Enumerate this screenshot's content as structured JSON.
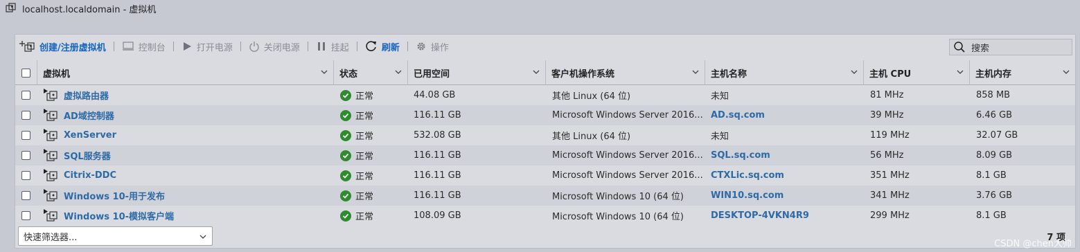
{
  "window": {
    "title": "localhost.localdomain - 虚拟机"
  },
  "toolbar": {
    "create": "创建/注册虚拟机",
    "console": "控制台",
    "power_on": "打开电源",
    "power_off": "关闭电源",
    "suspend": "挂起",
    "refresh": "刷新",
    "actions": "操作",
    "search_placeholder": "搜索"
  },
  "columns": [
    "虚拟机",
    "状态",
    "已用空间",
    "客户机操作系统",
    "主机名称",
    "主机 CPU",
    "主机内存"
  ],
  "rows": [
    {
      "name": "虚拟路由器",
      "status": "正常",
      "space": "44.08 GB",
      "os": "其他 Linux (64 位)",
      "host": "未知",
      "host_link": false,
      "cpu": "81 MHz",
      "mem": "858 MB"
    },
    {
      "name": "AD域控制器",
      "status": "正常",
      "space": "116.11 GB",
      "os": "Microsoft Windows Server 2016...",
      "host": "AD.sq.com",
      "host_link": true,
      "cpu": "39 MHz",
      "mem": "6.46 GB"
    },
    {
      "name": "XenServer",
      "status": "正常",
      "space": "532.08 GB",
      "os": "其他 Linux (64 位)",
      "host": "未知",
      "host_link": false,
      "cpu": "119 MHz",
      "mem": "32.07 GB"
    },
    {
      "name": "SQL服务器",
      "status": "正常",
      "space": "116.11 GB",
      "os": "Microsoft Windows Server 2016...",
      "host": "SQL.sq.com",
      "host_link": true,
      "cpu": "56 MHz",
      "mem": "8.09 GB"
    },
    {
      "name": "Citrix-DDC",
      "status": "正常",
      "space": "116.11 GB",
      "os": "Microsoft Windows Server 2016...",
      "host": "CTXLic.sq.com",
      "host_link": true,
      "cpu": "351 MHz",
      "mem": "8.1 GB"
    },
    {
      "name": "Windows 10-用于发布",
      "status": "正常",
      "space": "116.11 GB",
      "os": "Microsoft Windows 10 (64 位)",
      "host": "WIN10.sq.com",
      "host_link": true,
      "cpu": "341 MHz",
      "mem": "3.76 GB"
    },
    {
      "name": "Windows 10-模拟客户端",
      "status": "正常",
      "space": "108.09 GB",
      "os": "Microsoft Windows 10 (64 位)",
      "host": "DESKTOP-4VKN4R9",
      "host_link": true,
      "cpu": "299 MHz",
      "mem": "8.1 GB"
    }
  ],
  "footer": {
    "filter_placeholder": "快速筛选器...",
    "count": "7 项"
  },
  "watermark": "CSDN @chen大帅",
  "colors": {
    "link": "#2e6aa6",
    "accent": "#1565c0",
    "ok": "#2e8b2e"
  }
}
